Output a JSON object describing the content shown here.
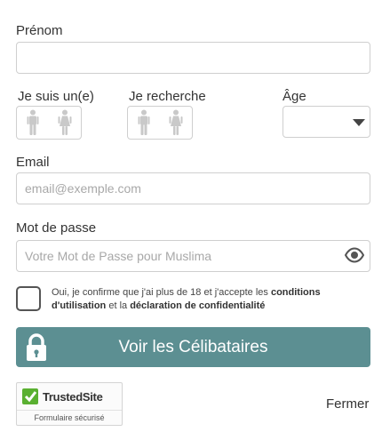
{
  "form": {
    "first_name": {
      "label": "Prénom",
      "value": "",
      "placeholder": ""
    },
    "i_am": {
      "label": "Je suis un(e)"
    },
    "looking_for": {
      "label": "Je recherche"
    },
    "age": {
      "label": "Âge",
      "value": ""
    },
    "email": {
      "label": "Email",
      "value": "",
      "placeholder": "email@exemple.com"
    },
    "password": {
      "label": "Mot de passe",
      "value": "",
      "placeholder": "Votre Mot de Passe pour Muslima"
    },
    "consent": {
      "checked": false,
      "text_1": "Oui, je confirme que j'ai plus de 18 et j'accepte les ",
      "terms_link": "conditions d'utilisation",
      "text_2": " et la ",
      "privacy_link": "déclaration de confidentialité"
    },
    "submit_label": "Voir les Célibataires"
  },
  "trusted_site": {
    "name": "TrustedSite",
    "subtitle": "Formulaire sécurisé"
  },
  "close_label": "Fermer",
  "colors": {
    "button": "#5c8f92",
    "border": "#cfcfcf",
    "trusted_green": "#5ab031"
  }
}
